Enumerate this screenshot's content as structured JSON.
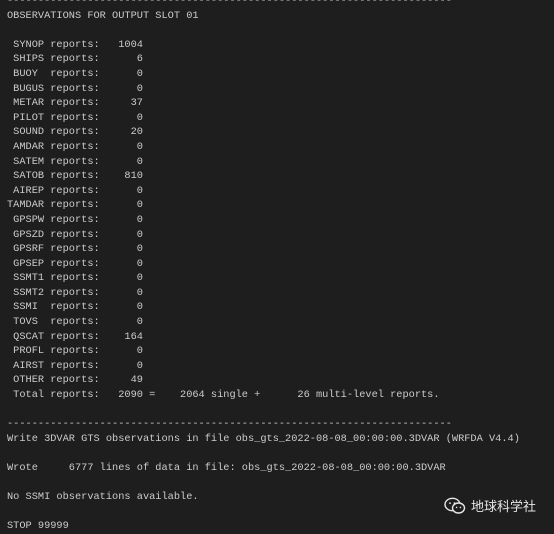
{
  "terminal": {
    "lines": [
      "------------------------------------------------------------------------",
      "OBSERVATIONS FOR OUTPUT SLOT 01",
      "",
      " SYNOP reports:   1004",
      " SHIPS reports:      6",
      " BUOY  reports:      0",
      " BUGUS reports:      0",
      " METAR reports:     37",
      " PILOT reports:      0",
      " SOUND reports:     20",
      " AMDAR reports:      0",
      " SATEM reports:      0",
      " SATOB reports:    810",
      " AIREP reports:      0",
      "TAMDAR reports:      0",
      " GPSPW reports:      0",
      " GPSZD reports:      0",
      " GPSRF reports:      0",
      " GPSEP reports:      0",
      " SSMT1 reports:      0",
      " SSMT2 reports:      0",
      " SSMI  reports:      0",
      " TOVS  reports:      0",
      " QSCAT reports:    164",
      " PROFL reports:      0",
      " AIRST reports:      0",
      " OTHER reports:     49",
      " Total reports:   2090 =    2064 single +      26 multi-level reports.",
      "",
      "------------------------------------------------------------------------",
      "Write 3DVAR GTS observations in file obs_gts_2022-08-08_00:00:00.3DVAR (WRFDA V4.4)",
      "",
      "Wrote     6777 lines of data in file: obs_gts_2022-08-08_00:00:00.3DVAR",
      "",
      "No SSMI observations available.",
      "",
      "STOP 99999"
    ]
  },
  "watermark": {
    "text": "地球科学社",
    "icon": "wechat-icon"
  }
}
